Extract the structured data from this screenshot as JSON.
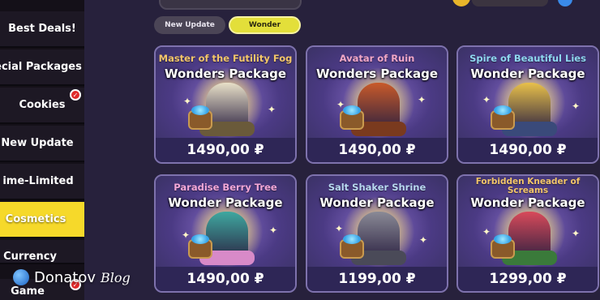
{
  "sidebar": {
    "items": [
      {
        "label": "Best Deals!",
        "badge": false,
        "active": false
      },
      {
        "label": "ecial Packages",
        "badge": false,
        "active": false
      },
      {
        "label": "Cookies",
        "badge": true,
        "active": false
      },
      {
        "label": "New Update",
        "badge": false,
        "active": false
      },
      {
        "label": "ime-Limited",
        "badge": false,
        "active": false
      },
      {
        "label": "Cosmetics",
        "badge": false,
        "active": true
      },
      {
        "label": "Currency",
        "badge": false,
        "active": false
      },
      {
        "label": "Game",
        "badge": true,
        "active": false
      }
    ]
  },
  "tabs": [
    {
      "label": "New Update",
      "active": false
    },
    {
      "label": "Wonder",
      "active": true
    }
  ],
  "cards": [
    {
      "name": "Master of the Futility Fog",
      "package": "Wonders Package",
      "price": "1490,00 ₽",
      "name_color": "#f3c66a",
      "building_color": "#e8e0c8",
      "base_color": "#6a5a3a"
    },
    {
      "name": "Avatar of Ruin",
      "package": "Wonders Package",
      "price": "1490,00 ₽",
      "name_color": "#f3a8c8",
      "building_color": "#c85a2a",
      "base_color": "#7a3a1e"
    },
    {
      "name": "Spire of Beautiful Lies",
      "package": "Wonder Package",
      "price": "1490,00 ₽",
      "name_color": "#8fd8f0",
      "building_color": "#e8c04a",
      "base_color": "#3a4a7a"
    },
    {
      "name": "Paradise Berry Tree",
      "package": "Wonder Package",
      "price": "1490,00 ₽",
      "name_color": "#f4a8d8",
      "building_color": "#3fa8a0",
      "base_color": "#d88ac8"
    },
    {
      "name": "Salt Shaker Shrine",
      "package": "Wonder Package",
      "price": "1199,00 ₽",
      "name_color": "#b8d8f0",
      "building_color": "#8a8a96",
      "base_color": "#4a4a58"
    },
    {
      "name": "Forbidden Kneader of Screams",
      "package": "Wonder Package",
      "price": "1299,00 ₽",
      "name_color": "#f3c66a",
      "building_color": "#d84a5a",
      "base_color": "#3a7a3a"
    }
  ],
  "watermark": {
    "brand": "Donatov",
    "suffix": "Blog"
  },
  "colors": {
    "accent": "#f6d92a",
    "card_bg": "#3b3266",
    "badge": "#e02a2a"
  }
}
